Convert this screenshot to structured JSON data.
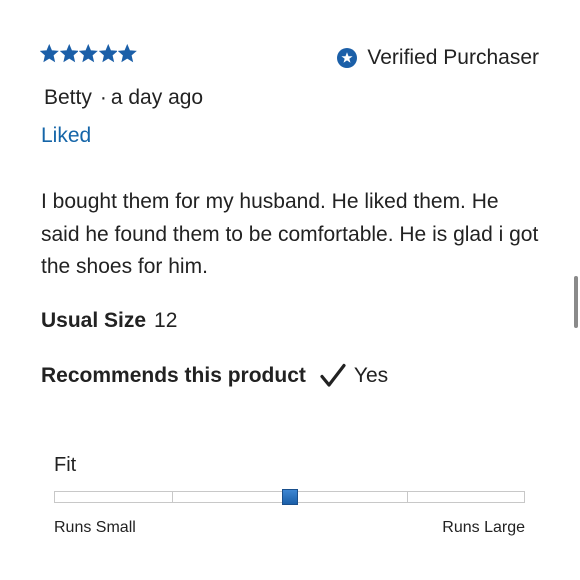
{
  "review": {
    "rating": 5,
    "rating_max": 5,
    "star_color": "#1b5fa8",
    "verified_icon": "verified-badge-icon",
    "verified_label": "Verified Purchaser",
    "author": "Betty",
    "separator": "·",
    "time_ago": "a day ago",
    "status": "Liked",
    "status_color": "#1565a8",
    "body": "I bought them for my husband. He liked them. He said he found them to be comfortable. He is glad i got the shoes for him.",
    "usual_size_label": "Usual Size",
    "usual_size_value": "12",
    "recommends_label": "Recommends this product",
    "recommends_icon": "checkmark-icon",
    "recommends_value": "Yes"
  },
  "fit": {
    "label": "Fit",
    "segments": 4,
    "value_fraction": 0.5,
    "min_label": "Runs Small",
    "max_label": "Runs Large",
    "marker_color": "#2f78c6"
  }
}
